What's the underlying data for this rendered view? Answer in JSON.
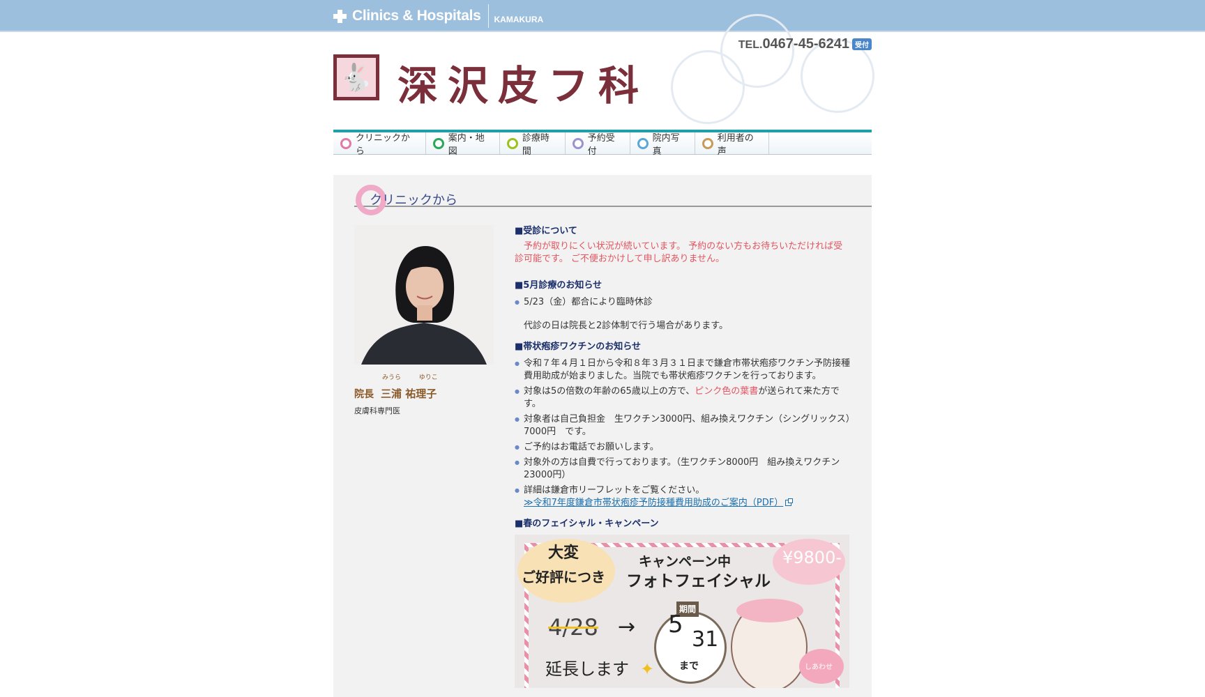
{
  "topbar": {
    "brand": "Clinics & Hospitals",
    "area": "KAMAKURA"
  },
  "header": {
    "clinic_name": "深沢皮フ科",
    "tel_prefix": "TEL.",
    "tel_number": "0467-45-6241",
    "tel_badge": "受付"
  },
  "nav": {
    "items": [
      {
        "label": "クリニックから",
        "color": "#e07aa6"
      },
      {
        "label": "案内・地図",
        "color": "#2aa85a"
      },
      {
        "label": "診療時間",
        "color": "#9cc21f"
      },
      {
        "label": "予約受付",
        "color": "#9a93cf"
      },
      {
        "label": "院内写真",
        "color": "#5aa7d8"
      },
      {
        "label": "利用者の声",
        "color": "#c79a5a"
      }
    ]
  },
  "section": {
    "title": "クリニックから"
  },
  "profile": {
    "ruby_family": "みうら",
    "ruby_given": "ゆりこ",
    "role": "院長",
    "name": "三浦 祐理子",
    "specialty": "皮膚科専門医"
  },
  "news": {
    "h1": "■受診について",
    "p1": "　予約が取りにくい状況が続いています。 予約のない方もお待ちいただければ受診可能です。 ご不便おかけして申し訳ありません。",
    "h2": "■5月診療のお知らせ",
    "b1": "5/23（金）都合により臨時休診",
    "p2": "代診の日は院長と2診体制で行う場合があります。",
    "h3": "■帯状疱疹ワクチンのお知らせ",
    "v1": "令和７年４月１日から令和８年３月３１日まで鎌倉市帯状疱疹ワクチン予防接種費用助成が始まりました。当院でも帯状疱疹ワクチンを行っております。",
    "v2_pre": "対象は5の倍数の年齢の65歳以上の方で、",
    "v2_pink": "ピンク色の葉書",
    "v2_post": "が送られて来た方です。",
    "v3": "対象者は自己負担金　生ワクチン3000円、組み換えワクチン（シングリックス）7000円　です。",
    "v4": "ご予約はお電話でお願いします。",
    "v5": "対象外の方は自費で行っております。（生ワクチン8000円　組み換えワクチン23000円）",
    "v6": "詳細は鎌倉市リーフレットをご覧ください。",
    "v6_link": "≫令和7年度鎌倉市帯状疱疹予防接種費用助成のご案内（PDF）",
    "h4": "■春のフェイシャル・キャンペーン"
  },
  "banner": {
    "bubble1": "大変",
    "bubble2": "ご好評につき",
    "line1": "キャンペーン中",
    "line2": "フォトフェイシャル",
    "price": "¥9800-",
    "old_date": "4/28",
    "arrow": "→",
    "period": "期間",
    "new_m": "5",
    "new_d": "31",
    "made": "まで",
    "extend": "延長します",
    "happy": "しあわせ"
  }
}
